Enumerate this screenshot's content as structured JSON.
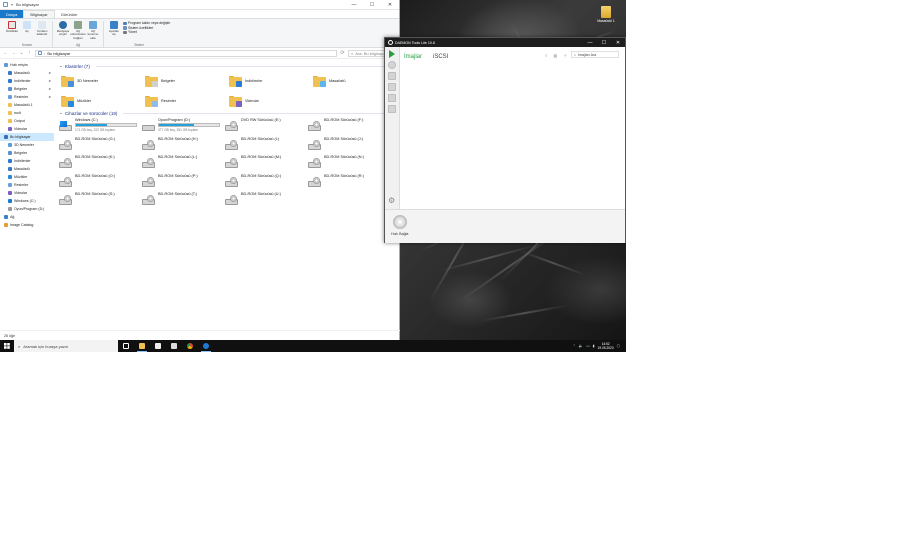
{
  "explorer": {
    "title": "Bu bilgisayar",
    "tabs": [
      "Dosya",
      "Bilgisayar",
      "Görünüm"
    ],
    "active_tab": "Bilgisayar",
    "ribbon": {
      "groups": [
        {
          "label": "Konum",
          "buttons": [
            "Özellikler",
            "Aç",
            "Yeniden adlandır"
          ]
        },
        {
          "label": "Ağ",
          "buttons": [
            "Medyaya erişim",
            "Ağ sürücüsüne bağlan",
            "Ağ konumu ekle"
          ]
        },
        {
          "label": "Sistem",
          "buttons": [
            "Ayarları Aç"
          ],
          "small": [
            "Program kaldır veya değiştir",
            "Sistem özellikleri",
            "Yönet"
          ]
        }
      ]
    },
    "address": "Bu bilgisayar",
    "search_placeholder": "Ara: Bu bilgisayar",
    "nav": [
      {
        "label": "Hızlı erişim",
        "top": true
      },
      {
        "label": "Masaüstü",
        "pin": true
      },
      {
        "label": "İndirilenler",
        "pin": true
      },
      {
        "label": "Belgeler",
        "pin": true
      },
      {
        "label": "Resimler",
        "pin": true
      },
      {
        "label": "Masaüstü 1"
      },
      {
        "label": "mult"
      },
      {
        "label": "Output"
      },
      {
        "label": "Videolar"
      },
      {
        "label": "Bu bilgisayar",
        "top": true,
        "selected": true
      },
      {
        "label": "3D Nesneler"
      },
      {
        "label": "Belgeler"
      },
      {
        "label": "İndirilenler"
      },
      {
        "label": "Masaüstü"
      },
      {
        "label": "Müzikler"
      },
      {
        "label": "Resimler"
      },
      {
        "label": "Videolar"
      },
      {
        "label": "Windows (C:)"
      },
      {
        "label": "Oyun/Program (D:)"
      },
      {
        "label": "Ağ",
        "top": true
      },
      {
        "label": "Image Catalog",
        "top": true
      }
    ],
    "folders_header": "Klasörler (7)",
    "folders": [
      "3D Nesneler",
      "Belgeler",
      "İndirilenler",
      "Masaüstü",
      "Müzikler",
      "Resimler",
      "Videolar"
    ],
    "drives_header": "Cihazlar ve sürücüler (19)",
    "drives": [
      {
        "label": "Windows (C:)",
        "type": "os",
        "used": 0.52,
        "sub": "171 GB boş, 222 GB toplam"
      },
      {
        "label": "Oyun/Program (D:)",
        "type": "hdd",
        "used": 0.58,
        "sub": "377 GB boş, 931 GB toplam"
      },
      {
        "label": "DVD RW Sürücüsü (E:)",
        "type": "disc"
      },
      {
        "label": "BD-ROM Sürücüsü (F:)",
        "type": "disc"
      },
      {
        "label": "BD-ROM Sürücüsü (G:)",
        "type": "disc"
      },
      {
        "label": "BD-ROM Sürücüsü (H:)",
        "type": "disc"
      },
      {
        "label": "BD-ROM Sürücüsü (I:)",
        "type": "disc"
      },
      {
        "label": "BD-ROM Sürücüsü (J:)",
        "type": "disc"
      },
      {
        "label": "BD-ROM Sürücüsü (K:)",
        "type": "disc"
      },
      {
        "label": "BD-ROM Sürücüsü (L:)",
        "type": "disc"
      },
      {
        "label": "BD-ROM Sürücüsü (M:)",
        "type": "disc"
      },
      {
        "label": "BD-ROM Sürücüsü (N:)",
        "type": "disc"
      },
      {
        "label": "BD-ROM Sürücüsü (O:)",
        "type": "disc"
      },
      {
        "label": "BD-ROM Sürücüsü (P:)",
        "type": "disc"
      },
      {
        "label": "BD-ROM Sürücüsü (Q:)",
        "type": "disc"
      },
      {
        "label": "BD-ROM Sürücüsü (R:)",
        "type": "disc"
      },
      {
        "label": "BD-ROM Sürücüsü (S:)",
        "type": "disc"
      },
      {
        "label": "BD-ROM Sürücüsü (T:)",
        "type": "disc"
      },
      {
        "label": "BD-ROM Sürücüsü (U:)",
        "type": "disc"
      }
    ],
    "status": "26 öğe"
  },
  "daemon": {
    "title": "DAEMON Tools Lite 10.8",
    "tabs": [
      "İmajlar",
      "iSCSI"
    ],
    "search_placeholder": "İmajları Ara",
    "quick_mount": "Hızlı Bağla"
  },
  "desktop": {
    "recycle_bin": "Masaüstü 1"
  },
  "taskbar": {
    "search_placeholder": "Aramak için buraya yazın",
    "time": "14:52",
    "date": "19.05.2020"
  },
  "colors": {
    "accent": "#1979ca",
    "daemon_green": "#2a9d3f",
    "drive_bar": "#26a0da",
    "taskbar": "#101010"
  }
}
